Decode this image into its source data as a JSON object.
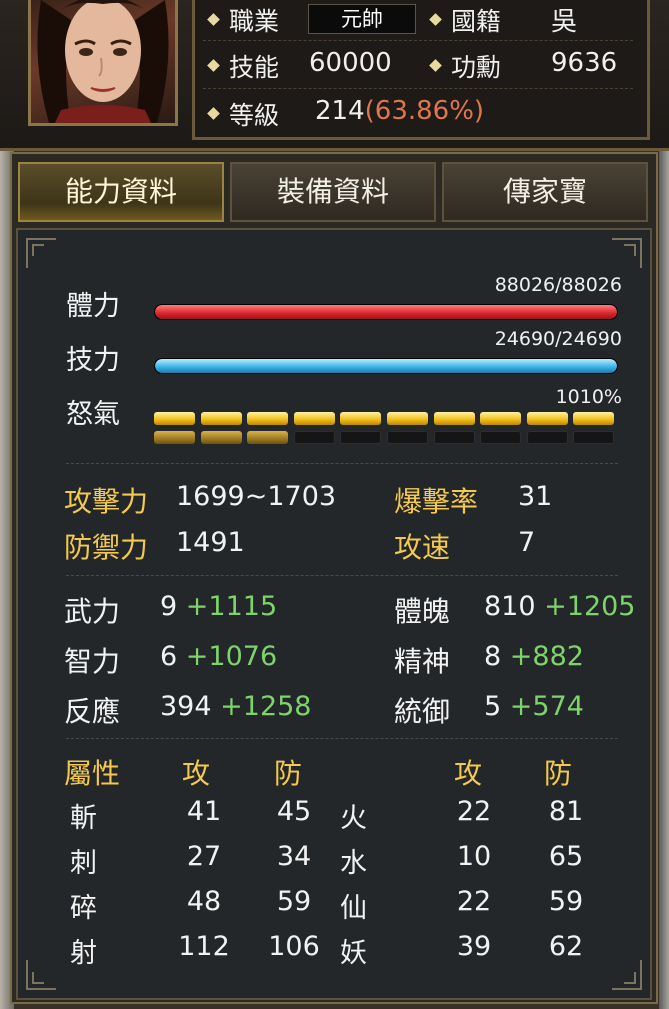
{
  "profile": {
    "job_label": "職業",
    "job_value": "元帥",
    "nation_label": "國籍",
    "nation_value": "吳",
    "skill_label": "技能",
    "skill_value": "60000",
    "merit_label": "功勳",
    "merit_value": "9636",
    "level_label": "等級",
    "level_value": "214",
    "level_pct": "(63.86%)"
  },
  "tabs": {
    "ability": "能力資料",
    "equipment": "裝備資料",
    "heirloom": "傳家寶",
    "active": "ability"
  },
  "bars": {
    "hp_label": "體力",
    "hp_value": "88026/88026",
    "hp_fraction": 1.0,
    "mp_label": "技力",
    "mp_value": "24690/24690",
    "mp_fraction": 1.0,
    "rage_label": "怒氣",
    "rage_value": "1010%",
    "rage_row1_lit": 10,
    "rage_row2_lit": 3,
    "rage_segments": 10
  },
  "combat": {
    "atk_label": "攻擊力",
    "atk_value": "1699~1703",
    "crit_label": "爆擊率",
    "crit_value": "31",
    "def_label": "防禦力",
    "def_value": "1491",
    "speed_label": "攻速",
    "speed_value": "7"
  },
  "attributes": {
    "str_label": "武力",
    "str_base": "9",
    "str_bonus": "+1115",
    "con_label": "體魄",
    "con_base": "810",
    "con_bonus": "+1205",
    "int_label": "智力",
    "int_base": "6",
    "int_bonus": "+1076",
    "spi_label": "精神",
    "spi_base": "8",
    "spi_bonus": "+882",
    "agi_label": "反應",
    "agi_base": "394",
    "agi_bonus": "+1258",
    "lead_label": "統御",
    "lead_base": "5",
    "lead_bonus": "+574"
  },
  "elements": {
    "header_label": "屬性",
    "atk_header": "攻",
    "def_header": "防",
    "atk_header2": "攻",
    "def_header2": "防",
    "rows": [
      {
        "l_name": "斬",
        "l_atk": "41",
        "l_def": "45",
        "r_name": "火",
        "r_atk": "22",
        "r_def": "81"
      },
      {
        "l_name": "刺",
        "l_atk": "27",
        "l_def": "34",
        "r_name": "水",
        "r_atk": "10",
        "r_def": "65"
      },
      {
        "l_name": "碎",
        "l_atk": "48",
        "l_def": "59",
        "r_name": "仙",
        "r_atk": "22",
        "r_def": "59"
      },
      {
        "l_name": "射",
        "l_atk": "112",
        "l_def": "106",
        "r_name": "妖",
        "r_atk": "39",
        "r_def": "62"
      }
    ]
  }
}
